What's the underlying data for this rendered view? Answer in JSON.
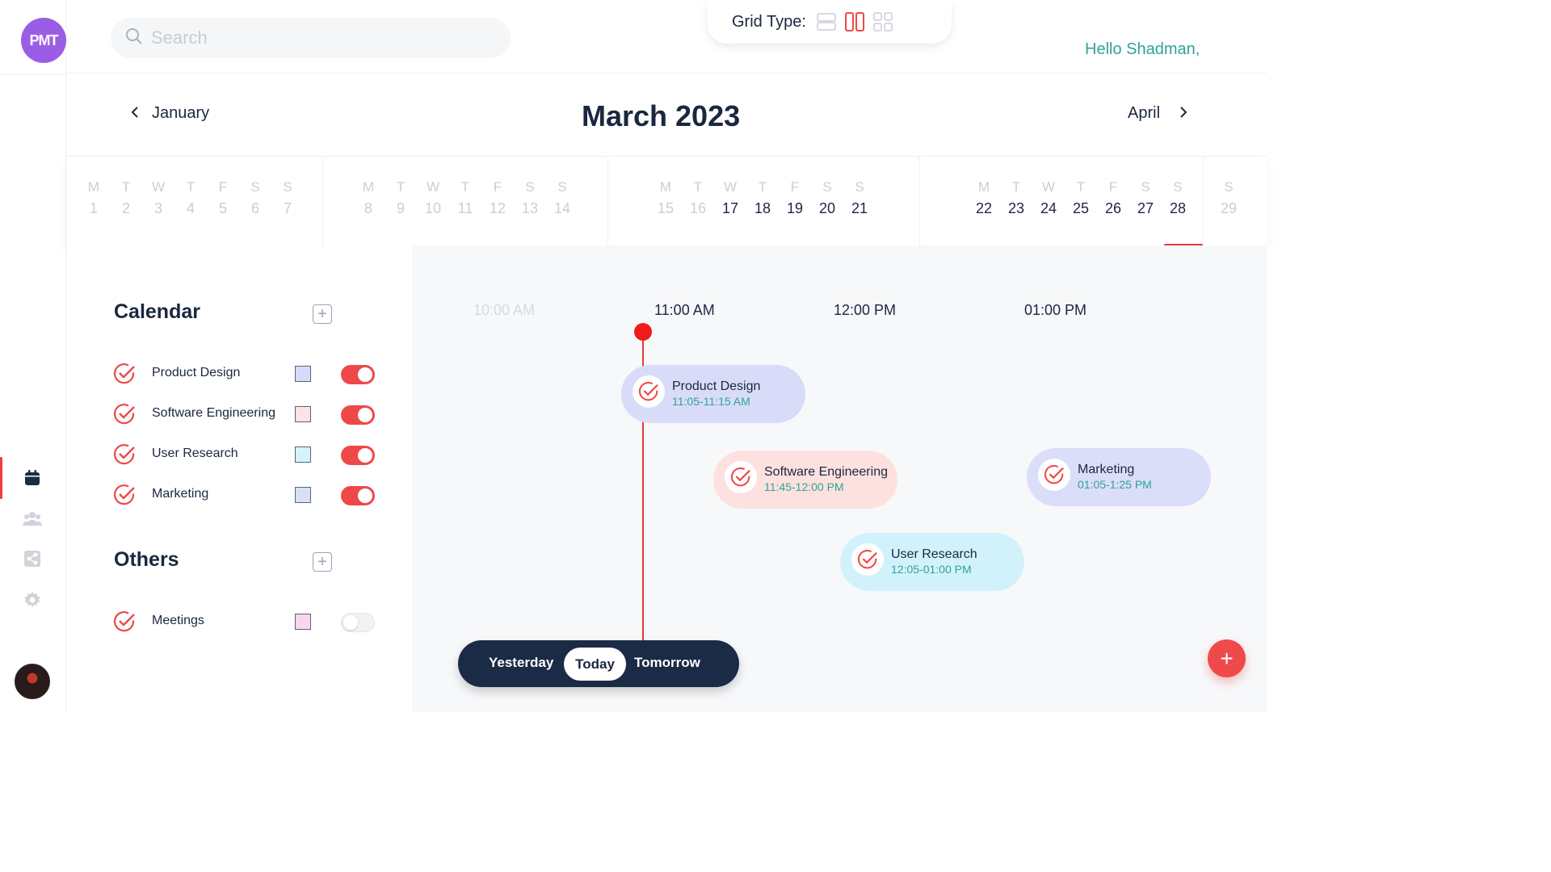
{
  "app": {
    "logo_text": "PMT"
  },
  "header": {
    "search_placeholder": "Search",
    "grid_type_label": "Grid Type:",
    "greeting": "Hello Shadman,"
  },
  "month_nav": {
    "prev": "January",
    "title": "March 2023",
    "next": "April"
  },
  "weeks": [
    {
      "days": [
        [
          "M",
          "1",
          false
        ],
        [
          "T",
          "2",
          false
        ],
        [
          "W",
          "3",
          false
        ],
        [
          "T",
          "4",
          false
        ],
        [
          "F",
          "5",
          false
        ],
        [
          "S",
          "6",
          false
        ],
        [
          "S",
          "7",
          false
        ]
      ]
    },
    {
      "days": [
        [
          "M",
          "8",
          false
        ],
        [
          "T",
          "9",
          false
        ],
        [
          "W",
          "10",
          false
        ],
        [
          "T",
          "11",
          false
        ],
        [
          "F",
          "12",
          false
        ],
        [
          "S",
          "13",
          false
        ],
        [
          "S",
          "14",
          false
        ]
      ]
    },
    {
      "days": [
        [
          "M",
          "15",
          false
        ],
        [
          "T",
          "16",
          false
        ],
        [
          "W",
          "17",
          true
        ],
        [
          "T",
          "18",
          true
        ],
        [
          "F",
          "19",
          true
        ],
        [
          "S",
          "20",
          true
        ],
        [
          "S",
          "21",
          true
        ]
      ]
    },
    {
      "days": [
        [
          "M",
          "22",
          true
        ],
        [
          "T",
          "23",
          true
        ],
        [
          "W",
          "24",
          true
        ],
        [
          "T",
          "25",
          true
        ],
        [
          "F",
          "26",
          true
        ],
        [
          "S",
          "27",
          true
        ],
        [
          "S",
          "28",
          true
        ]
      ]
    },
    {
      "days": [
        [
          "S",
          "29",
          false
        ]
      ]
    }
  ],
  "sidebar": {
    "calendar_title": "Calendar",
    "calendars": [
      {
        "name": "Product Design",
        "color": "#d7dbf8",
        "enabled": true
      },
      {
        "name": "Software Engineering",
        "color": "#fde3e1",
        "enabled": true
      },
      {
        "name": "User Research",
        "color": "#d4f3fb",
        "enabled": true
      },
      {
        "name": "Marketing",
        "color": "#dadff8",
        "enabled": true
      }
    ],
    "others_title": "Others",
    "others": [
      {
        "name": "Meetings",
        "color": "#f8d6ee",
        "enabled": false
      }
    ]
  },
  "timeline": {
    "times": [
      "10:00 AM",
      "11:00 AM",
      "12:00 PM",
      "01:00 PM"
    ],
    "events": [
      {
        "title": "Product Design",
        "time": "11:05-11:15 AM",
        "color": "#d8dcf8"
      },
      {
        "title": "Software Engineering",
        "time": "11:45-12:00 PM",
        "color": "#fde1df"
      },
      {
        "title": "Marketing",
        "time": "01:05-1:25 PM",
        "color": "#dadef8"
      },
      {
        "title": "User Research",
        "time": "12:05-01:00 PM",
        "color": "#d2f2fb"
      }
    ]
  },
  "day_switch": {
    "yesterday": "Yesterday",
    "today": "Today",
    "tomorrow": "Tomorrow"
  },
  "fab_label": "+",
  "colors": {
    "accent": "#ef4848",
    "primary_dark": "#1b2b45",
    "teal": "#2fa39a",
    "brand": "#9b5de5"
  }
}
